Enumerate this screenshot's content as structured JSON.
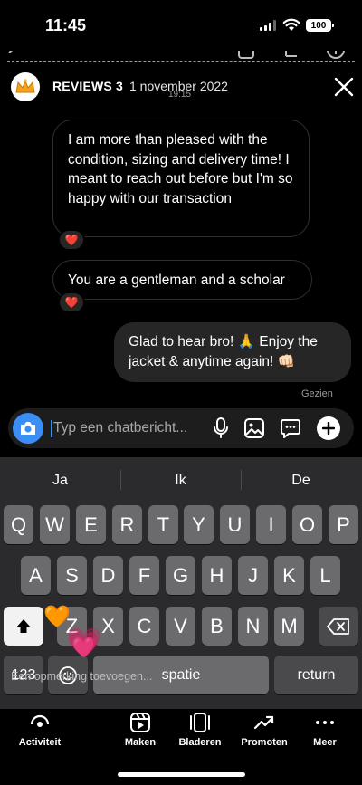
{
  "status_bar": {
    "time": "11:45",
    "battery": "100"
  },
  "header": {
    "name": "REVIEWS 3",
    "date": "1 november 2022",
    "time": "19:15"
  },
  "messages": [
    {
      "direction": "in",
      "text": "I am more than pleased with the condition,  sizing and delivery time!  I meant to reach out before but I'm so happy with our transaction",
      "reaction": "❤️"
    },
    {
      "direction": "in",
      "text": "You are a gentleman and a scholar",
      "reaction": "❤️"
    },
    {
      "direction": "out",
      "text": "Glad to hear bro! 🙏 Enjoy the jacket & anytime again! 👊🏻"
    }
  ],
  "seen_label": "Gezien",
  "composer": {
    "placeholder": "Typ een chatbericht..."
  },
  "keyboard": {
    "suggestions": [
      "Ja",
      "Ik",
      "De"
    ],
    "row1": [
      "Q",
      "W",
      "E",
      "R",
      "T",
      "Y",
      "U",
      "I",
      "O",
      "P"
    ],
    "row2": [
      "A",
      "S",
      "D",
      "F",
      "G",
      "H",
      "J",
      "K",
      "L"
    ],
    "row3": [
      "Z",
      "X",
      "C",
      "V",
      "B",
      "N",
      "M"
    ],
    "numbers_key": "123",
    "space_key": "spatie",
    "return_key": "return",
    "floating_emoji_1": "🧡",
    "floating_emoji_2": "💗"
  },
  "overlay_caption": "Een opmerking toevoegen...",
  "bottom_nav": [
    {
      "label": "Activiteit",
      "icon": "activity-icon"
    },
    {
      "label": "Maken",
      "icon": "create-reel-icon"
    },
    {
      "label": "Bladeren",
      "icon": "browse-icon"
    },
    {
      "label": "Promoten",
      "icon": "promote-icon"
    },
    {
      "label": "Meer",
      "icon": "more-icon"
    }
  ],
  "colors": {
    "accent": "#3a8ef5",
    "outgoing_bubble": "#262626",
    "keyboard_bg": "#2b2b2d"
  }
}
